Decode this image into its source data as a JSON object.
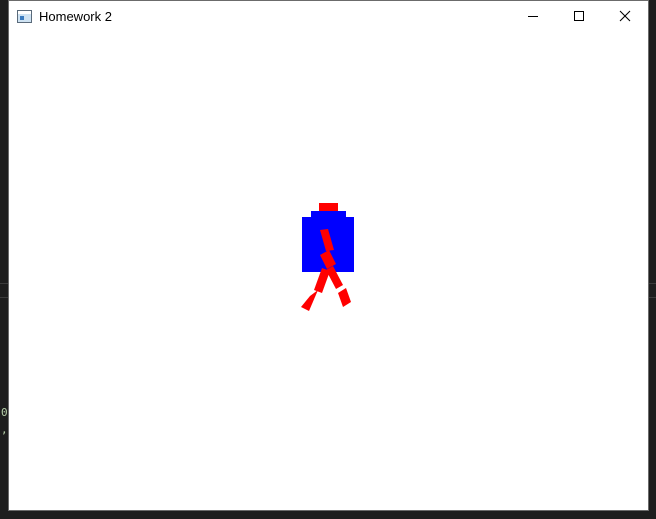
{
  "window": {
    "title": "Homework 2",
    "controls": [
      "minimize-icon",
      "maximize-icon",
      "close-icon"
    ]
  },
  "background_text": [
    "0",
    ","
  ],
  "figure": {
    "hat_color": "#ff0000",
    "body_color": "#0000ff",
    "limb_color": "#ff0000"
  }
}
